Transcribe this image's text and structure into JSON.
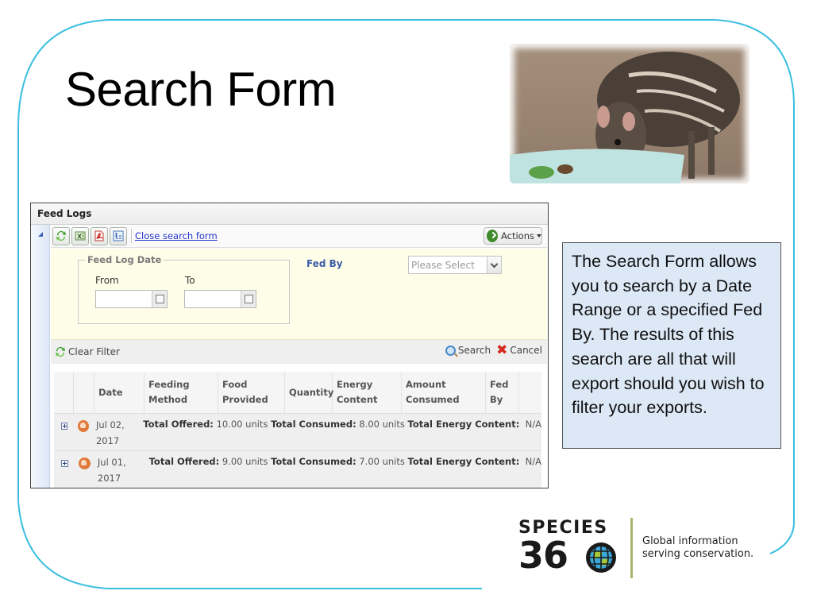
{
  "slide": {
    "title": "Search Form",
    "frame_color": "#3bbfe0",
    "callout_text": "The Search Form allows you to search by a Date Range or a specified Fed By. The results of this search are all that will export should you wish to filter your exports.",
    "photo_alt": "Striped rodent eating from a bowl",
    "logo": {
      "word": "SPECIES",
      "number": "36",
      "globe_icon": "globe-icon",
      "tagline_line1": "Global information",
      "tagline_line2": "serving conservation."
    }
  },
  "app": {
    "panel_title": "Feed Logs",
    "toolbar": {
      "buttons": [
        {
          "name": "refresh",
          "icon": "refresh-icon"
        },
        {
          "name": "export-excel",
          "icon": "excel-icon"
        },
        {
          "name": "export-pdf",
          "icon": "pdf-icon"
        },
        {
          "name": "column-chooser",
          "icon": "columns-icon"
        }
      ],
      "close_search_link": "Close search form",
      "actions_label": "Actions"
    },
    "search_form": {
      "date_group_legend": "Feed Log Date",
      "from_label": "From",
      "from_value": "",
      "to_label": "To",
      "to_value": "",
      "fed_by_label": "Fed By",
      "fed_by_selected": "Please Select"
    },
    "filter_bar": {
      "clear_filter_label": "Clear Filter",
      "search_label": "Search",
      "cancel_label": "Cancel"
    },
    "grid": {
      "columns": [
        {
          "line1": "",
          "line2": ""
        },
        {
          "line1": "",
          "line2": ""
        },
        {
          "line1": "Date",
          "line2": ""
        },
        {
          "line1": "Feeding",
          "line2": "Method"
        },
        {
          "line1": "Food",
          "line2": "Provided"
        },
        {
          "line1": "Quantity",
          "line2": ""
        },
        {
          "line1": "Energy",
          "line2": "Content"
        },
        {
          "line1": "Amount",
          "line2": "Consumed"
        },
        {
          "line1": "Fed",
          "line2": "By"
        },
        {
          "line1": "",
          "line2": ""
        }
      ],
      "rows": [
        {
          "date_line1": "Jul 02,",
          "date_line2": "2017",
          "total_offered_label": "Total Offered:",
          "total_offered_value": "10.00 units",
          "total_consumed_label": "Total Consumed:",
          "total_consumed_value": "8.00 units",
          "total_energy_label": "Total Energy Content:",
          "total_energy_value": "N/A"
        },
        {
          "date_line1": "Jul 01,",
          "date_line2": "2017",
          "total_offered_label": "Total Offered:",
          "total_offered_value": "9.00 units",
          "total_consumed_label": "Total Consumed:",
          "total_consumed_value": "7.00 units",
          "total_energy_label": "Total Energy Content:",
          "total_energy_value": "N/A"
        }
      ]
    }
  }
}
